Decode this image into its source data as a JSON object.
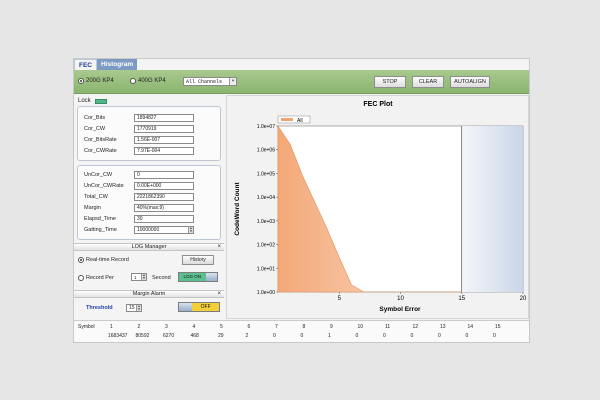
{
  "tabs": [
    {
      "label": "FEC"
    },
    {
      "label": "Histogram"
    }
  ],
  "toolbar": {
    "radio_200g": "200G KP4",
    "radio_400g": "400G KP4",
    "channel_select": "All Channels",
    "stop_label": "STOP",
    "clear_label": "CLEAR",
    "autoalign_label": "AUTOALIGN"
  },
  "lock": {
    "label": "Lock",
    "led_color": "#4fb78a"
  },
  "correctable": {
    "rows": [
      {
        "label": "Cor_Bits",
        "value": "1894827"
      },
      {
        "label": "Cor_CW",
        "value": "1770919"
      },
      {
        "label": "Cor_BitsRate",
        "value": "1.56E-007"
      },
      {
        "label": "Cor_CWRate",
        "value": "7.97E-004"
      }
    ]
  },
  "uncorrectable": {
    "rows": [
      {
        "label": "UnCor_CW",
        "value": "0"
      },
      {
        "label": "UnCor_CWRate",
        "value": "0.00E+000"
      },
      {
        "label": "Total_CW",
        "value": "2221862390"
      },
      {
        "label": "Margin",
        "value": "40%(max:9)"
      },
      {
        "label": "Elapsd_Time",
        "value": "30"
      },
      {
        "label": "Gatting_Time",
        "value": "10000000"
      }
    ]
  },
  "log_manager": {
    "title": "LOG Manager",
    "close": "×",
    "realtime_label": "Real-time Record",
    "history_label": "History",
    "record_per_label": "Record Per",
    "record_per_value": "1",
    "second_label": "Second",
    "log_on_label": "LOG ON"
  },
  "margin_alarm": {
    "title": "Margin Alarm",
    "close": "×",
    "threshold_label": "Threshold",
    "threshold_value": "15",
    "toggle_label": "OFF"
  },
  "chart_data": {
    "type": "area",
    "title": "FEC Plot",
    "xlabel": "Symbol Error",
    "ylabel": "CodeWord Count",
    "legend": [
      "All"
    ],
    "legend_position": "top-left",
    "x_ticks": [
      "5",
      "10",
      "15",
      "20"
    ],
    "y_ticks": [
      "1.0e+00",
      "1.0e+01",
      "1.0e+02",
      "1.0e+03",
      "1.0e+04",
      "1.0e+05",
      "1.0e+06",
      "1.0e+07"
    ],
    "xlim": [
      0,
      20
    ],
    "ylim_log10": [
      0,
      7
    ],
    "marker_x": 15,
    "series": [
      {
        "name": "All",
        "color": "#f0a46e",
        "x": [
          0,
          1,
          2,
          3,
          4,
          5,
          6,
          7,
          8,
          9,
          10,
          11,
          12,
          13,
          14,
          15
        ],
        "y": [
          2221862390,
          1683437,
          80592,
          6270,
          468,
          29,
          2,
          0,
          0,
          0,
          0,
          0,
          0,
          0,
          0,
          0
        ]
      }
    ]
  },
  "symbol_table": {
    "header": "Symbol",
    "columns": [
      "1",
      "2",
      "3",
      "4",
      "5",
      "6",
      "7",
      "8",
      "9",
      "10",
      "11",
      "12",
      "13",
      "14",
      "15"
    ],
    "values": [
      "1683437",
      "80592",
      "6270",
      "468",
      "29",
      "2",
      "0",
      "0",
      "1",
      "0",
      "0",
      "0",
      "0",
      "0",
      "0"
    ]
  }
}
